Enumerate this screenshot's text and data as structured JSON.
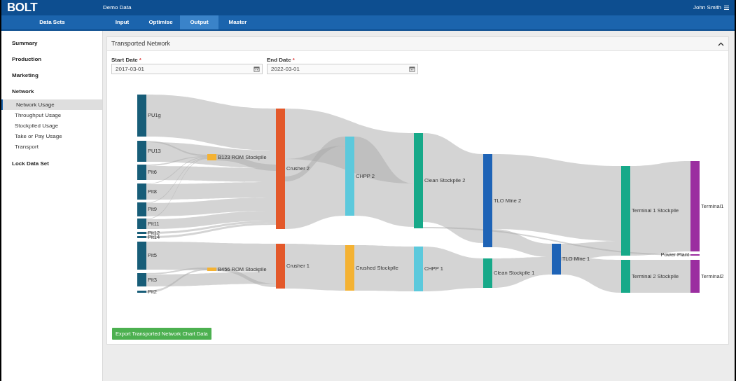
{
  "header": {
    "logo": "BOLT",
    "dataset": "Demo Data",
    "user": "John Smith"
  },
  "nav": {
    "section": "Data Sets",
    "tabs": [
      {
        "label": "Input",
        "selected": false
      },
      {
        "label": "Optimise",
        "selected": false
      },
      {
        "label": "Output",
        "selected": true
      },
      {
        "label": "Master",
        "selected": false
      }
    ]
  },
  "sidebar": {
    "items": [
      {
        "label": "Summary",
        "selected": false
      },
      {
        "label": "Production",
        "selected": false
      },
      {
        "label": "Marketing",
        "selected": false
      },
      {
        "label": "Network",
        "selected": false,
        "children": [
          {
            "label": "Network Usage",
            "selected": true
          },
          {
            "label": "Throughput Usage",
            "selected": false
          },
          {
            "label": "Stockpiled Usage",
            "selected": false
          },
          {
            "label": "Take or Pay Usage",
            "selected": false
          },
          {
            "label": "Transport",
            "selected": false
          }
        ]
      },
      {
        "label": "Lock Data Set",
        "selected": false
      }
    ]
  },
  "panel": {
    "title": "Transported Network",
    "expanded": true,
    "fields": [
      {
        "label": "Start Date",
        "required_mark": "*",
        "value": "2017-03-01"
      },
      {
        "label": "End Date",
        "required_mark": "*",
        "value": "2022-03-01"
      }
    ],
    "sankey": {
      "nodes": [
        {
          "label": "PU1g",
          "color": "#175d78"
        },
        {
          "label": "PU13",
          "color": "#175d78"
        },
        {
          "label": "Pit6",
          "color": "#175d78"
        },
        {
          "label": "Pit8",
          "color": "#175d78"
        },
        {
          "label": "Pit9",
          "color": "#175d78"
        },
        {
          "label": "Pit11",
          "color": "#175d78"
        },
        {
          "label": "Pit12",
          "color": "#175d78"
        },
        {
          "label": "Pit14",
          "color": "#175d78"
        },
        {
          "label": "Pit5",
          "color": "#175d78"
        },
        {
          "label": "Pit3",
          "color": "#175d78"
        },
        {
          "label": "Pit2",
          "color": "#175d78"
        },
        {
          "label": "B123 ROM Stockpile",
          "color": "#f4b233"
        },
        {
          "label": "B456 ROM Stockpile",
          "color": "#f4b233"
        },
        {
          "label": "Crusher 2",
          "color": "#e3582a"
        },
        {
          "label": "Crusher 1",
          "color": "#e3582a"
        },
        {
          "label": "CHPP 2",
          "color": "#5cc9dc"
        },
        {
          "label": "Crushed Stockpile",
          "color": "#f4b233"
        },
        {
          "label": "Clean Stockpile 2",
          "color": "#17a989"
        },
        {
          "label": "CHPP 1",
          "color": "#5cc9dc"
        },
        {
          "label": "TLO Mine 2",
          "color": "#1e63b6"
        },
        {
          "label": "Clean Stockpile 1",
          "color": "#17a989"
        },
        {
          "label": "TLO Mine 1",
          "color": "#1e63b6"
        },
        {
          "label": "Terminal 1 Stockpile",
          "color": "#17a989"
        },
        {
          "label": "Terminal 2 Stockpile",
          "color": "#17a989"
        },
        {
          "label": "Terminal1",
          "color": "#9b2ea0"
        },
        {
          "label": "Power Plant",
          "color": "#9b2ea0"
        },
        {
          "label": "Terminal2",
          "color": "#9b2ea0"
        }
      ]
    },
    "export_button": "Export Transported Network Chart Data"
  }
}
